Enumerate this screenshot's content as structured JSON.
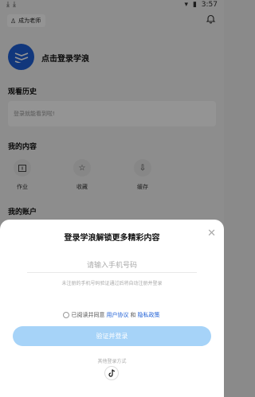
{
  "status_bar": {
    "time": "3:57"
  },
  "header": {
    "teacher_label": "成为老师"
  },
  "profile": {
    "login_prompt": "点击登录学浪"
  },
  "history": {
    "title": "观看历史",
    "empty_text": "登录就能看到啦!"
  },
  "my_content": {
    "title": "我的内容",
    "items": [
      {
        "label": "作业",
        "icon": "homework-icon"
      },
      {
        "label": "收藏",
        "icon": "star-icon"
      },
      {
        "label": "缓存",
        "icon": "download-icon"
      }
    ]
  },
  "account": {
    "title": "我的账户"
  },
  "login_sheet": {
    "title": "登录学浪解锁更多精彩内容",
    "phone_placeholder": "请输入手机号码",
    "hint": "未注册的手机号码验证通过后将自动注册并登录",
    "agree_prefix": "已阅读并同意",
    "user_agreement": "用户协议",
    "and": "和",
    "privacy_policy": "隐私政策",
    "login_button": "验证并登录",
    "other_methods": "其他登录方式"
  },
  "colors": {
    "accent": "#1e5fd6",
    "button": "#a6d3f8"
  }
}
